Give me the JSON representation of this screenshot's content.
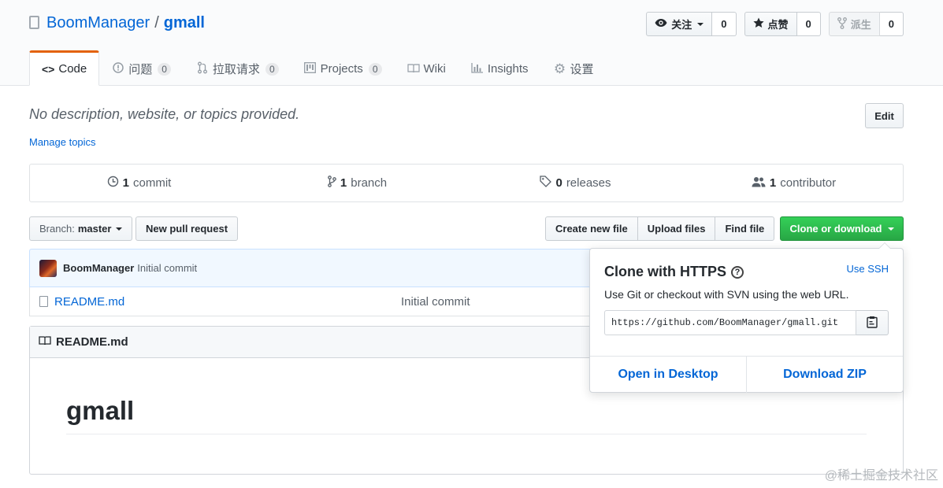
{
  "repo": {
    "owner": "BoomManager",
    "separator": "/",
    "name": "gmall"
  },
  "actions": {
    "watch_label": "关注",
    "watch_count": "0",
    "star_label": "点赞",
    "star_count": "0",
    "fork_label": "派生",
    "fork_count": "0"
  },
  "nav": [
    {
      "label": "Code",
      "selected": true
    },
    {
      "label": "问题",
      "counter": "0"
    },
    {
      "label": "拉取请求",
      "counter": "0"
    },
    {
      "label": "Projects",
      "counter": "0"
    },
    {
      "label": "Wiki"
    },
    {
      "label": "Insights"
    },
    {
      "label": "设置"
    }
  ],
  "description": "No description, website, or topics provided.",
  "manage_topics": "Manage topics",
  "edit_label": "Edit",
  "summary": {
    "commits_num": "1",
    "commits_label": "commit",
    "branches_num": "1",
    "branches_label": "branch",
    "releases_num": "0",
    "releases_label": "releases",
    "contributors_num": "1",
    "contributors_label": "contributor"
  },
  "file_nav": {
    "branch_prefix": "Branch:",
    "branch_name": "master",
    "new_pr": "New pull request",
    "create_file": "Create new file",
    "upload_files": "Upload files",
    "find_file": "Find file",
    "clone": "Clone or download"
  },
  "commit": {
    "author": "BoomManager",
    "message": "Initial commit"
  },
  "files": [
    {
      "name": "README.md",
      "message": "Initial commit"
    }
  ],
  "readme": {
    "title": "README.md",
    "heading": "gmall"
  },
  "clone_dropdown": {
    "title": "Clone with HTTPS",
    "use_ssh": "Use SSH",
    "subtitle": "Use Git or checkout with SVN using the web URL.",
    "url": "https://github.com/BoomManager/gmall.git",
    "open_desktop": "Open in Desktop",
    "download_zip": "Download ZIP"
  },
  "watermark": "@稀土掘金技术社区",
  "colors": {
    "link": "#0366d6",
    "accent_tab": "#e36209",
    "clone_green": "#28a745"
  }
}
